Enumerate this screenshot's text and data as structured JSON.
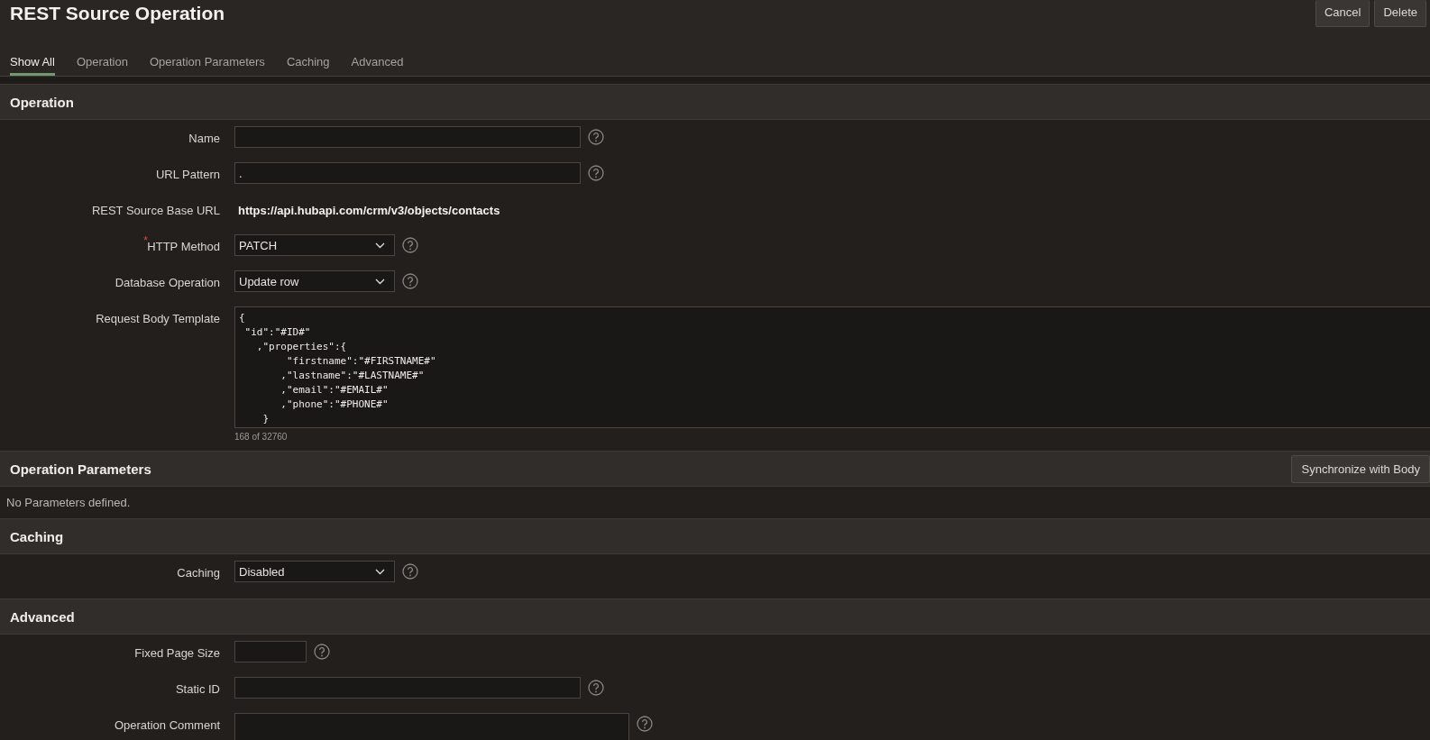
{
  "page_title": "REST Source Operation",
  "header_buttons": [
    "Cancel",
    "Delete"
  ],
  "tabs": [
    {
      "label": "Show All",
      "selected": true
    },
    {
      "label": "Operation",
      "selected": false
    },
    {
      "label": "Operation Parameters",
      "selected": false
    },
    {
      "label": "Caching",
      "selected": false
    },
    {
      "label": "Advanced",
      "selected": false
    }
  ],
  "sections": [
    {
      "title": "Operation",
      "fields": [
        {
          "kind": "text",
          "label": "Name",
          "help": true
        },
        {
          "kind": "text",
          "label": "URL Pattern",
          "value": ".",
          "help": true
        },
        {
          "kind": "display",
          "label": "REST Source Base URL",
          "value": "https://api.hubapi.com/crm/v3/objects/contacts",
          "help": false
        },
        {
          "kind": "select",
          "label": "HTTP Method",
          "value": "PATCH",
          "required_mark": "*",
          "help": true
        },
        {
          "kind": "select",
          "label": "Database Operation",
          "value": "Update row",
          "help": true
        },
        {
          "kind": "code",
          "label": "Request Body Template",
          "value": "{\n \"id\":\"#ID#\"\n   ,\"properties\":{\n        \"firstname\":\"#FIRSTNAME#\"\n       ,\"lastname\":\"#LASTNAME#\"\n       ,\"email\":\"#EMAIL#\"\n       ,\"phone\":\"#PHONE#\"\n    }",
          "counter": "168 of 32760",
          "help": false
        }
      ]
    },
    {
      "title": "Operation Parameters",
      "button": "Synchronize with Body",
      "message": "No Parameters defined."
    },
    {
      "title": "Caching",
      "fields": [
        {
          "kind": "select",
          "label": "Caching",
          "value": "Disabled",
          "help": true
        }
      ]
    },
    {
      "title": "Advanced",
      "fields": [
        {
          "kind": "short-text",
          "label": "Fixed Page Size",
          "help": true
        },
        {
          "kind": "text",
          "label": "Static ID",
          "help": true
        },
        {
          "kind": "comment",
          "label": "Operation Comment",
          "help": true
        }
      ]
    }
  ]
}
